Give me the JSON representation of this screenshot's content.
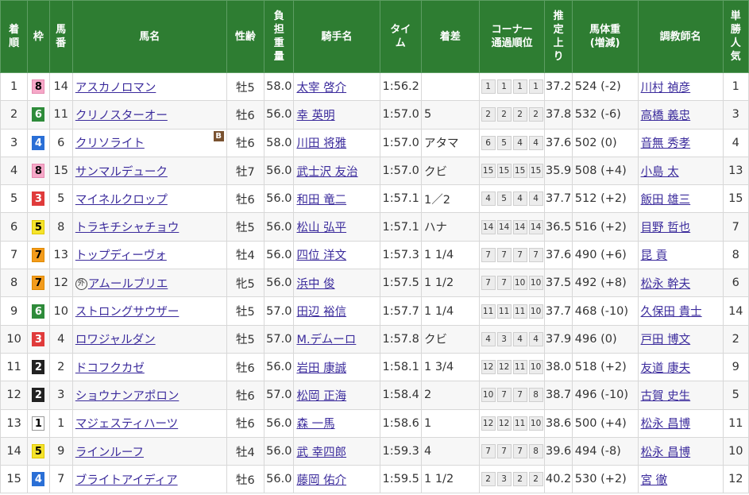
{
  "headers": {
    "rank": "着順",
    "waku": "枠",
    "umaban": "馬番",
    "horse": "馬名",
    "sexage": "性齢",
    "weight": "負担重量",
    "jockey": "騎手名",
    "time": "タイム",
    "margin": "着差",
    "corner_line1": "コーナー",
    "corner_line2": "通過順位",
    "last3f": "推定上り",
    "bw_line1": "馬体重",
    "bw_line2": "(増減)",
    "trainer": "調教師名",
    "pop": "単勝人気"
  },
  "rows": [
    {
      "rank": "1",
      "waku": "8",
      "umaban": "14",
      "horse": "アスカノロマン",
      "sexage": "牡5",
      "weight": "58.0",
      "jockey": "太宰 啓介",
      "time": "1:56.2",
      "margin": "",
      "corners": [
        "1",
        "1",
        "1",
        "1"
      ],
      "last3f": "37.2",
      "bodyweight": "524 (-2)",
      "trainer": "川村 禎彦",
      "pop": "1",
      "blinker": "",
      "foreign": ""
    },
    {
      "rank": "2",
      "waku": "6",
      "umaban": "11",
      "horse": "クリノスターオー",
      "sexage": "牡6",
      "weight": "56.0",
      "jockey": "幸 英明",
      "time": "1:57.0",
      "margin": "5",
      "corners": [
        "2",
        "2",
        "2",
        "2"
      ],
      "last3f": "37.8",
      "bodyweight": "532 (-6)",
      "trainer": "高橋 義忠",
      "pop": "3",
      "blinker": "",
      "foreign": ""
    },
    {
      "rank": "3",
      "waku": "4",
      "umaban": "6",
      "horse": "クリソライト",
      "sexage": "牡6",
      "weight": "58.0",
      "jockey": "川田 将雅",
      "time": "1:57.0",
      "margin": "アタマ",
      "corners": [
        "6",
        "5",
        "4",
        "4"
      ],
      "last3f": "37.6",
      "bodyweight": "502 (0)",
      "trainer": "音無 秀孝",
      "pop": "4",
      "blinker": "B",
      "foreign": ""
    },
    {
      "rank": "4",
      "waku": "8",
      "umaban": "15",
      "horse": "サンマルデューク",
      "sexage": "牡7",
      "weight": "56.0",
      "jockey": "武士沢 友治",
      "time": "1:57.0",
      "margin": "クビ",
      "corners": [
        "15",
        "15",
        "15",
        "15"
      ],
      "last3f": "35.9",
      "bodyweight": "508 (+4)",
      "trainer": "小島 太",
      "pop": "13",
      "blinker": "",
      "foreign": ""
    },
    {
      "rank": "5",
      "waku": "3",
      "umaban": "5",
      "horse": "マイネルクロップ",
      "sexage": "牡6",
      "weight": "56.0",
      "jockey": "和田 竜二",
      "time": "1:57.1",
      "margin": "1／2",
      "corners": [
        "4",
        "5",
        "4",
        "4"
      ],
      "last3f": "37.7",
      "bodyweight": "512 (+2)",
      "trainer": "飯田 雄三",
      "pop": "15",
      "blinker": "",
      "foreign": ""
    },
    {
      "rank": "6",
      "waku": "5",
      "umaban": "8",
      "horse": "トラキチシャチョウ",
      "sexage": "牡5",
      "weight": "56.0",
      "jockey": "松山 弘平",
      "time": "1:57.1",
      "margin": "ハナ",
      "corners": [
        "14",
        "14",
        "14",
        "14"
      ],
      "last3f": "36.5",
      "bodyweight": "516 (+2)",
      "trainer": "目野 哲也",
      "pop": "7",
      "blinker": "",
      "foreign": ""
    },
    {
      "rank": "7",
      "waku": "7",
      "umaban": "13",
      "horse": "トップディーヴォ",
      "sexage": "牡4",
      "weight": "56.0",
      "jockey": "四位 洋文",
      "time": "1:57.3",
      "margin": "1 1/4",
      "corners": [
        "7",
        "7",
        "7",
        "7"
      ],
      "last3f": "37.6",
      "bodyweight": "490 (+6)",
      "trainer": "昆 貢",
      "pop": "8",
      "blinker": "",
      "foreign": ""
    },
    {
      "rank": "8",
      "waku": "7",
      "umaban": "12",
      "horse": "アムールブリエ",
      "sexage": "牝5",
      "weight": "56.0",
      "jockey": "浜中 俊",
      "time": "1:57.5",
      "margin": "1 1/2",
      "corners": [
        "7",
        "7",
        "10",
        "10"
      ],
      "last3f": "37.5",
      "bodyweight": "492 (+8)",
      "trainer": "松永 幹夫",
      "pop": "6",
      "blinker": "",
      "foreign": "外"
    },
    {
      "rank": "9",
      "waku": "6",
      "umaban": "10",
      "horse": "ストロングサウザー",
      "sexage": "牡5",
      "weight": "57.0",
      "jockey": "田辺 裕信",
      "time": "1:57.7",
      "margin": "1 1/4",
      "corners": [
        "11",
        "11",
        "11",
        "10"
      ],
      "last3f": "37.7",
      "bodyweight": "468 (-10)",
      "trainer": "久保田 貴士",
      "pop": "14",
      "blinker": "",
      "foreign": ""
    },
    {
      "rank": "10",
      "waku": "3",
      "umaban": "4",
      "horse": "ロワジャルダン",
      "sexage": "牡5",
      "weight": "57.0",
      "jockey": "M.デムーロ",
      "time": "1:57.8",
      "margin": "クビ",
      "corners": [
        "4",
        "3",
        "4",
        "4"
      ],
      "last3f": "37.9",
      "bodyweight": "496 (0)",
      "trainer": "戸田 博文",
      "pop": "2",
      "blinker": "",
      "foreign": ""
    },
    {
      "rank": "11",
      "waku": "2",
      "umaban": "2",
      "horse": "ドコフクカゼ",
      "sexage": "牡6",
      "weight": "56.0",
      "jockey": "岩田 康誠",
      "time": "1:58.1",
      "margin": "1 3/4",
      "corners": [
        "12",
        "12",
        "11",
        "10"
      ],
      "last3f": "38.0",
      "bodyweight": "518 (+2)",
      "trainer": "友道 康夫",
      "pop": "9",
      "blinker": "",
      "foreign": ""
    },
    {
      "rank": "12",
      "waku": "2",
      "umaban": "3",
      "horse": "ショウナンアポロン",
      "sexage": "牡6",
      "weight": "57.0",
      "jockey": "松岡 正海",
      "time": "1:58.4",
      "margin": "2",
      "corners": [
        "10",
        "7",
        "7",
        "8"
      ],
      "last3f": "38.7",
      "bodyweight": "496 (-10)",
      "trainer": "古賀 史生",
      "pop": "5",
      "blinker": "",
      "foreign": ""
    },
    {
      "rank": "13",
      "waku": "1",
      "umaban": "1",
      "horse": "マジェスティハーツ",
      "sexage": "牡6",
      "weight": "56.0",
      "jockey": "森 一馬",
      "time": "1:58.6",
      "margin": "1",
      "corners": [
        "12",
        "12",
        "11",
        "10"
      ],
      "last3f": "38.6",
      "bodyweight": "500 (+4)",
      "trainer": "松永 昌博",
      "pop": "11",
      "blinker": "",
      "foreign": ""
    },
    {
      "rank": "14",
      "waku": "5",
      "umaban": "9",
      "horse": "ラインルーフ",
      "sexage": "牡4",
      "weight": "56.0",
      "jockey": "武 幸四郎",
      "time": "1:59.3",
      "margin": "4",
      "corners": [
        "7",
        "7",
        "7",
        "8"
      ],
      "last3f": "39.6",
      "bodyweight": "494 (-8)",
      "trainer": "松永 昌博",
      "pop": "10",
      "blinker": "",
      "foreign": ""
    },
    {
      "rank": "15",
      "waku": "4",
      "umaban": "7",
      "horse": "ブライトアイディア",
      "sexage": "牡6",
      "weight": "56.0",
      "jockey": "藤岡 佑介",
      "time": "1:59.5",
      "margin": "1 1/2",
      "corners": [
        "2",
        "3",
        "2",
        "2"
      ],
      "last3f": "40.2",
      "bodyweight": "530 (+2)",
      "trainer": "宮 徹",
      "pop": "12",
      "blinker": "",
      "foreign": ""
    }
  ]
}
